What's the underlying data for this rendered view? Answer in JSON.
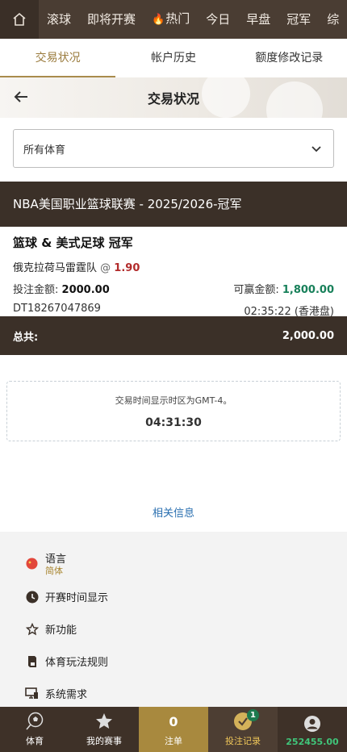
{
  "nav": {
    "items": [
      "滚球",
      "即将开赛",
      "热门",
      "今日",
      "早盘",
      "冠军",
      "综"
    ]
  },
  "tabs": [
    "交易状况",
    "帐户历史",
    "额度修改记录"
  ],
  "header": {
    "title": "交易状况"
  },
  "filter": {
    "selected": "所有体育"
  },
  "bet": {
    "league": "NBA美国职业篮球联赛 - 2025/2026-冠军",
    "market": "篮球 & 美式足球 冠军",
    "selection": "俄克拉荷马雷霆队",
    "at": "@",
    "odds": "1.90",
    "stake_label": "投注金额:",
    "stake": "2000.00",
    "win_label": "可赢金额:",
    "win": "1,800.00",
    "ticket_id": "DT18267047869",
    "time": "02:35:22 (香港盘)"
  },
  "total": {
    "label": "总共:",
    "value": "2,000.00"
  },
  "timezone": {
    "note": "交易时间显示时区为GMT-4。",
    "clock": "04:31:30"
  },
  "related_link": "相关信息",
  "footer_menu": {
    "language_label": "语言",
    "language_value": "简体",
    "kickoff_time": "开赛时间显示",
    "new_features": "新功能",
    "sport_rules": "体育玩法规则",
    "system_req": "系统需求"
  },
  "bottom_bar": {
    "sports": "体育",
    "my_events": "我的赛事",
    "slip_count": "0",
    "slip": "注单",
    "bet_record": "投注记录",
    "record_badge": "1",
    "balance": "252455.00"
  },
  "colors": {
    "dark_brown": "#3b3028",
    "gold": "#a8893e",
    "green": "#18805a",
    "red": "#b22b2b"
  }
}
